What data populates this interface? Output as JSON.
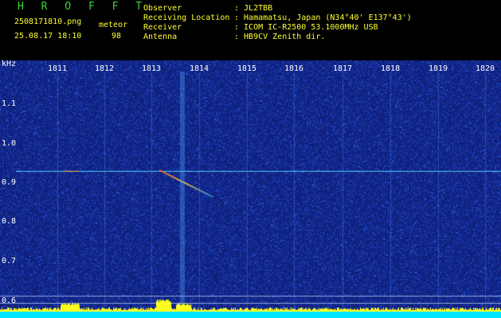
{
  "header": {
    "app_title": "H R O F F T",
    "file_name": "2508171810.png",
    "mode_label": "meteor",
    "datetime": "25.08.17 18:10",
    "count": "98"
  },
  "info": [
    {
      "label": "Observer",
      "value": ": JL2TBB"
    },
    {
      "label": "Receiving Location",
      "value": ": Hamamatsu, Japan (N34°40' E137°43')"
    },
    {
      "label": "Receiver",
      "value": ": ICOM IC-R2500 53.1000MHz USB"
    },
    {
      "label": "Antenna",
      "value": ": HB9CV Zenith dir."
    }
  ],
  "plot": {
    "y_unit": "kHz",
    "time_ticks": [
      "1811",
      "1812",
      "1813",
      "1814",
      "1815",
      "1816",
      "1817",
      "1818",
      "1819",
      "1820"
    ],
    "freq_ticks": [
      "1.1",
      "1.0",
      "0.9",
      "0.8",
      "0.7",
      "0.6"
    ],
    "colors": {
      "background": "#10207a",
      "text": "#ffffff",
      "header_green": "#3cd23c",
      "header_yellow": "#ffff30"
    }
  }
}
